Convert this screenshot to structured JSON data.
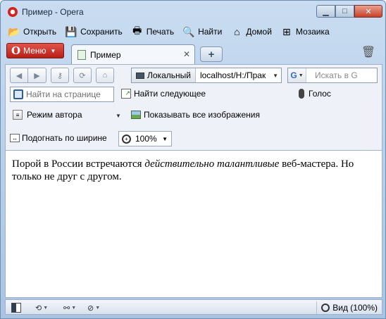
{
  "window": {
    "title": "Пример - Opera",
    "caption": {
      "minimize": "▁",
      "maximize": "□",
      "close": "✕"
    }
  },
  "bookmarks": [
    {
      "label": "Открыть",
      "icon": "folder-icon"
    },
    {
      "label": "Сохранить",
      "icon": "floppy-icon"
    },
    {
      "label": "Печать",
      "icon": "printer-icon"
    },
    {
      "label": "Найти",
      "icon": "search-icon"
    },
    {
      "label": "Домой",
      "icon": "home-icon"
    },
    {
      "label": "Мозаика",
      "icon": "speed-dial-icon"
    }
  ],
  "menu": {
    "label": "Меню"
  },
  "tab": {
    "title": "Пример"
  },
  "address": {
    "security_label": "Локальный",
    "url": "localhost/H:/Прак"
  },
  "search": {
    "engine": "G",
    "placeholder": "Искать в G"
  },
  "find": {
    "placeholder": "Найти на странице",
    "next_label": "Найти следующее",
    "voice_label": "Голос"
  },
  "author": {
    "mode_label": "Режим автора",
    "show_images_label": "Показывать все изображения"
  },
  "fit": {
    "label": "Подогнать по ширине",
    "zoom_value": "100%"
  },
  "content": {
    "text_before": "Порой в России встречаются ",
    "text_em": "действительно талантливые",
    "text_after": " веб-мастера. Но только не друг с другом."
  },
  "status": {
    "view_label": "Вид (100%)"
  },
  "colors": {
    "menu_red": "#c9302c",
    "frame_blue": "#b5cde8"
  }
}
